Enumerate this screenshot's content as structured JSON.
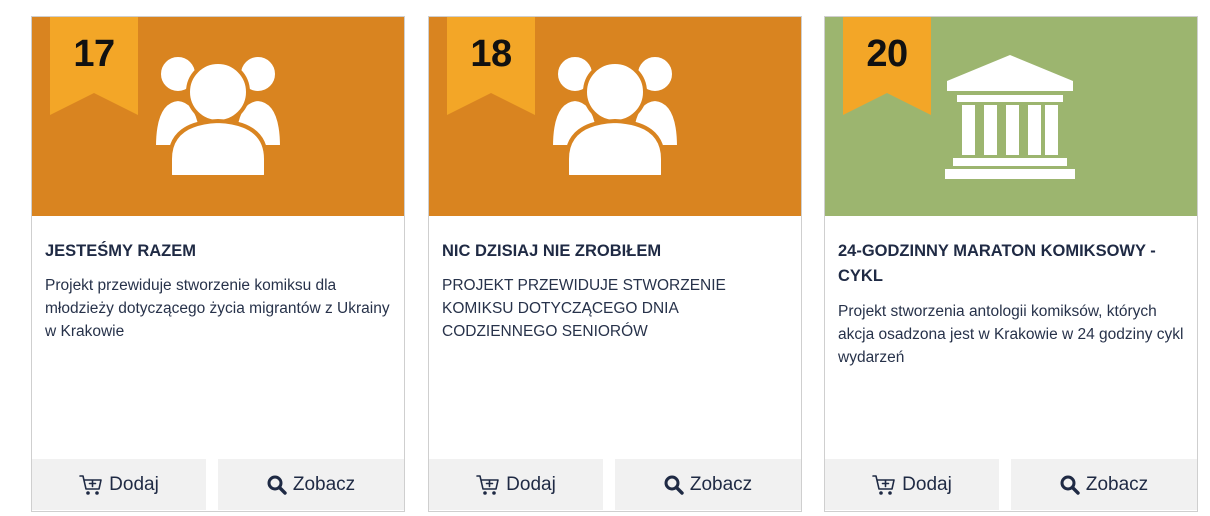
{
  "colors": {
    "orange_tile": "#d98420",
    "green_tile": "#9cb56f",
    "badge": "#f3a627",
    "button_bg": "#f1f1f1",
    "text_dark": "#1f2a44"
  },
  "cards": [
    {
      "number": "17",
      "icon": "people-group-icon",
      "title": "JESTEŚMY RAZEM",
      "description": "Projekt przewiduje stworzenie komiksu dla młodzieży dotyczącego życia migrantów z Ukrainy w Krakowie",
      "add_label": "Dodaj",
      "view_label": "Zobacz"
    },
    {
      "number": "18",
      "icon": "people-group-icon",
      "title": "NIC DZISIAJ NIE ZROBIŁEM",
      "description": "PROJEKT PRZEWIDUJE STWORZENIE KOMIKSU DOTYCZĄCEGO DNIA CODZIENNEGO SENIORÓW",
      "add_label": "Dodaj",
      "view_label": "Zobacz"
    },
    {
      "number": "20",
      "icon": "institution-building-icon",
      "title": "24-GODZINNY MARATON KOMIKSOWY - CYKL",
      "description": "Projekt stworzenia antologii komiksów, których akcja osadzona jest w Krakowie w 24 godziny cykl wydarzeń",
      "add_label": "Dodaj",
      "view_label": "Zobacz"
    }
  ]
}
